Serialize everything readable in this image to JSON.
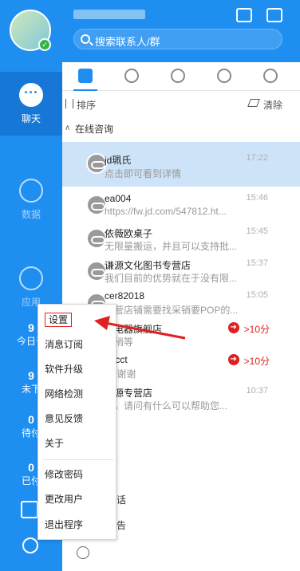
{
  "header": {
    "search_placeholder": "搜索联系人/群"
  },
  "sidebar": {
    "nav": [
      {
        "label": "聊天"
      },
      {
        "label": "数据"
      },
      {
        "label": "应用"
      }
    ],
    "stats": [
      {
        "num": "9",
        "label": "今日咨"
      },
      {
        "num": "9",
        "label": "未下"
      },
      {
        "num": "0",
        "label": "待付"
      },
      {
        "num": "0",
        "label": "已付"
      }
    ]
  },
  "toolbar": {
    "sort_label": "排序",
    "clear_label": "清除",
    "section_label": "在线咨询"
  },
  "conversations": [
    {
      "name": "jd珮氏",
      "msg": "点击即可看到详情",
      "time": "17:22"
    },
    {
      "name": "ea004",
      "msg": "https://fw.jd.com/547812.ht...",
      "time": "15:46"
    },
    {
      "name": "依薇欧桌子",
      "msg": "无限量搬运，并且可以支持批...",
      "time": "15:45"
    },
    {
      "name": "谦源文化图书专营店",
      "msg": "我们目前的优势就在于没有限...",
      "time": "15:37"
    },
    {
      "name": "cer82018",
      "msg": "宁营店铺需要找采销要POP的...",
      "time": "15:05"
    },
    {
      "name": "月电器旗舰店",
      "msg": "的稍等",
      "warn": ">10分"
    },
    {
      "name": "_gcct",
      "msg": "的  谢谢",
      "warn": ">10分"
    },
    {
      "name": "瑞源专营店",
      "msg": "的，请问有什么可以帮助您...",
      "time": "10:37"
    }
  ],
  "bottom": {
    "line1": "话",
    "line2": "告"
  },
  "menu": {
    "items": [
      "设置",
      "消息订阅",
      "软件升级",
      "网络检测",
      "意见反馈",
      "关于",
      "修改密码",
      "更改用户",
      "退出程序"
    ]
  },
  "colors": {
    "brand": "#1f8ef1",
    "warning": "#e02020"
  }
}
